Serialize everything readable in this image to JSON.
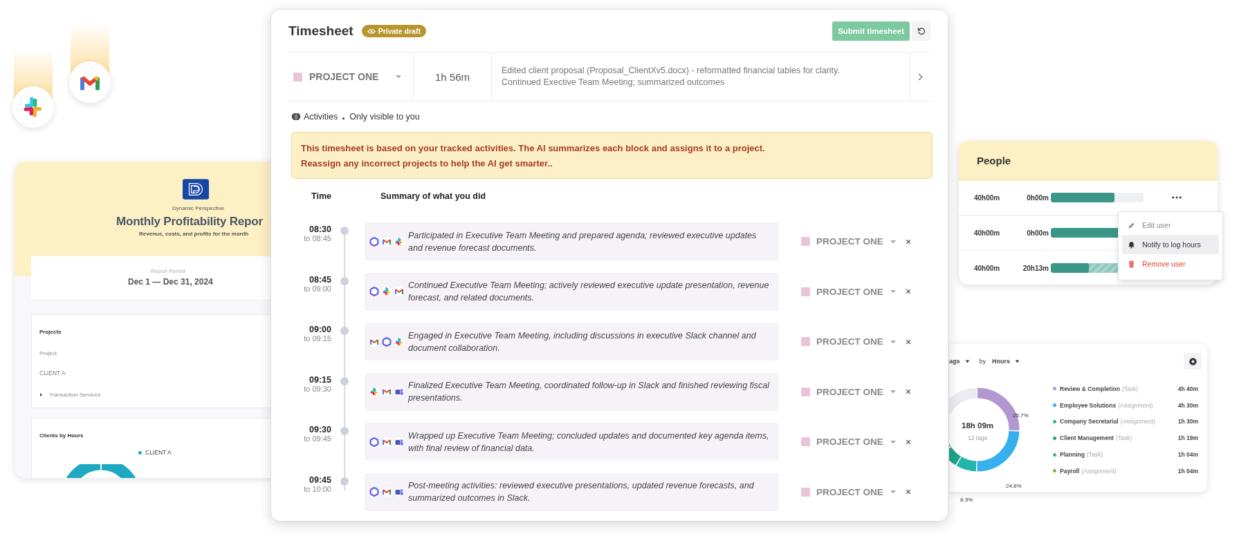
{
  "report": {
    "org": "Dynamic Perspective",
    "title": "Monthly Profitability Repor",
    "subtitle": "Revenue, costs, and profits for the month",
    "period_label": "Report Period",
    "period": "Dec 1 — Dec 31, 2024",
    "projects_title": "Projects",
    "projects_column": "Project",
    "client": "CLIENT A",
    "project_item": "Transaction Services",
    "clients_title": "Clients  by Hours",
    "clients_legend": "CLIENT A"
  },
  "timesheet": {
    "title": "Timesheet",
    "badge": "Private draft",
    "submit": "Submit timesheet",
    "entry": {
      "project": "PROJECT ONE",
      "duration": "1h 56m",
      "description_lines": [
        "Edited client proposal (Proposal_ClientXv5.docx) - reformatted financial tables for clarity.",
        "Continued Exective Team Meeting; summarized outcomes"
      ]
    },
    "activities_label": "Activities",
    "visibility": "Only visible to you",
    "notice_lines": [
      "This timesheet is based on your tracked activities. The AI summarizes each block and assigns it to a project.",
      "Reassign any incorrect projects to help the AI get smarter.."
    ],
    "columns": [
      "Time",
      "Summary of what you did"
    ],
    "activities": [
      {
        "start": "08:30",
        "end": "to 08:45",
        "apps": [
          {
            "kind": "hexagon"
          },
          {
            "kind": "mail"
          },
          {
            "kind": "pinwheel"
          }
        ],
        "summary": "Participated in Executive Team Meeting and prepared agenda; reviewed executive updates and revenue forecast documents.",
        "project": "PROJECT ONE"
      },
      {
        "start": "08:45",
        "end": "to 09:00",
        "apps": [
          {
            "kind": "hexagon"
          },
          {
            "kind": "pinwheel"
          },
          {
            "kind": "mail"
          }
        ],
        "summary": "Continued Executive Team Meeting; actively reviewed executive update presentation, revenue forecast, and related documents.",
        "project": "PROJECT ONE"
      },
      {
        "start": "09:00",
        "end": "to 09:15",
        "apps": [
          {
            "kind": "mail"
          },
          {
            "kind": "hexagon"
          },
          {
            "kind": "pinwheel"
          }
        ],
        "summary": "Engaged in Executive Team Meeting, including discussions in executive Slack channel and document collaboration.",
        "project": "PROJECT ONE"
      },
      {
        "start": "09:15",
        "end": "to 09:30",
        "apps": [
          {
            "kind": "pinwheel"
          },
          {
            "kind": "mail"
          },
          {
            "kind": "chat"
          }
        ],
        "summary": "Finalized Executive Team Meeting, coordinated follow-up in Slack and finished reviewing fiscal presentations.",
        "project": "PROJECT ONE"
      },
      {
        "start": "09:30",
        "end": "to 09:45",
        "apps": [
          {
            "kind": "hexagon"
          },
          {
            "kind": "mail"
          },
          {
            "kind": "chat"
          }
        ],
        "summary": "Wrapped up Executive Team Meeting; concluded updates and documented key agenda items, with final review of financial data.",
        "project": "PROJECT ONE"
      },
      {
        "start": "09:45",
        "end": "to 10:00",
        "apps": [
          {
            "kind": "hexagon"
          },
          {
            "kind": "mail"
          },
          {
            "kind": "chat"
          }
        ],
        "summary": "Post-meeting activities: reviewed executive presentations, updated revenue forecasts, and summarized outcomes in Slack.",
        "project": "PROJECT ONE"
      }
    ]
  },
  "people": {
    "title": "People",
    "rows": [
      {
        "planned": "40h00m",
        "logged": "0h00m",
        "level": 0.69
      },
      {
        "planned": "40h00m",
        "logged": "0h00m",
        "level": 0.9
      },
      {
        "planned": "40h00m",
        "logged": "20h13m",
        "level": 0.41,
        "pending": {
          "level": 0.85
        }
      }
    ],
    "menu": [
      {
        "label": "Edit user",
        "kind": "edit",
        "selected": false
      },
      {
        "label": "Notify to log hours",
        "kind": "notify",
        "selected": true
      },
      {
        "label": "Remove user",
        "kind": "remove",
        "selected": false
      }
    ]
  },
  "tags_chart": {
    "group_by": "ags",
    "by_label": "by",
    "metric": "Hours",
    "total": "18h 09m",
    "count": "12 tags",
    "percent_labels": [
      "25.7%",
      "24.8%",
      "8.3%"
    ],
    "legend": [
      {
        "name": "Review & Completion",
        "type": "(Task)",
        "value": "4h 40m",
        "color": "#b397d1"
      },
      {
        "name": "Employee Solutions",
        "type": "(Assignment)",
        "value": "4h 30m",
        "color": "#36b0ef"
      },
      {
        "name": "Company Secretarial",
        "type": "(Assignment)",
        "value": "1h 30m",
        "color": "#22b5ab"
      },
      {
        "name": "Client Management",
        "type": "(Task)",
        "value": "1h 19m",
        "color": "#1fa38a"
      },
      {
        "name": "Planning",
        "type": "(Task)",
        "value": "1h 04m",
        "color": "#4bb57a"
      },
      {
        "name": "Payroll",
        "type": "(Assignment)",
        "value": "1h 04m",
        "color": "#7ab843"
      }
    ]
  }
}
